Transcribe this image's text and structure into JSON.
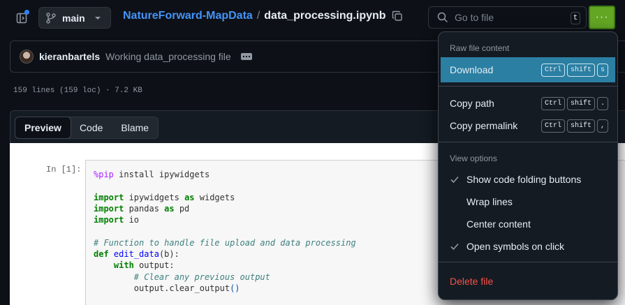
{
  "header": {
    "branch": "main",
    "repo": "NatureForward-MapData",
    "separator": "/",
    "file": "data_processing.ipynb",
    "search_placeholder": "Go to file",
    "search_shortcut": "t",
    "more_label": "···"
  },
  "commit": {
    "author": "kieranbartels",
    "message": "Working data_processing file"
  },
  "file_info": "159 lines (159 loc) · 7.2 KB",
  "view_tabs": [
    "Preview",
    "Code",
    "Blame"
  ],
  "notebook": {
    "prompt": "In [1]:"
  },
  "menu": {
    "section_raw": "Raw file content",
    "download": "Download",
    "download_keys": [
      "Ctrl",
      "shift",
      "s"
    ],
    "copy_path": "Copy path",
    "copy_path_keys": [
      "Ctrl",
      "shift",
      "."
    ],
    "copy_permalink": "Copy permalink",
    "copy_permalink_keys": [
      "Ctrl",
      "shift",
      ","
    ],
    "section_view": "View options",
    "show_folding": "Show code folding buttons",
    "wrap_lines": "Wrap lines",
    "center_content": "Center content",
    "open_symbols": "Open symbols on click",
    "delete_file": "Delete file"
  },
  "colors": {
    "accent": "#4493f8",
    "highlight": "#2b7fa3",
    "danger": "#f85149",
    "more_button": "#63a624"
  }
}
